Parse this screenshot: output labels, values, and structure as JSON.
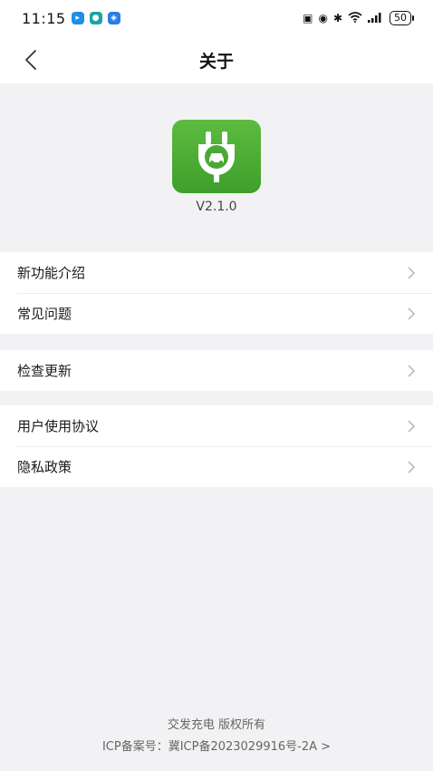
{
  "status_bar": {
    "time": "11:15",
    "battery": "50"
  },
  "nav": {
    "title": "关于"
  },
  "app": {
    "version": "V2.1.0"
  },
  "menu_groups": [
    {
      "items": [
        "新功能介绍",
        "常见问题"
      ]
    },
    {
      "items": [
        "检查更新"
      ]
    },
    {
      "items": [
        "用户使用协议",
        "隐私政策"
      ]
    }
  ],
  "footer": {
    "copyright": "交发充电 版权所有",
    "icp": "ICP备案号：冀ICP备2023029916号-2A >"
  },
  "colors": {
    "icon_green": "#4caf39",
    "background": "#f2f2f4"
  }
}
